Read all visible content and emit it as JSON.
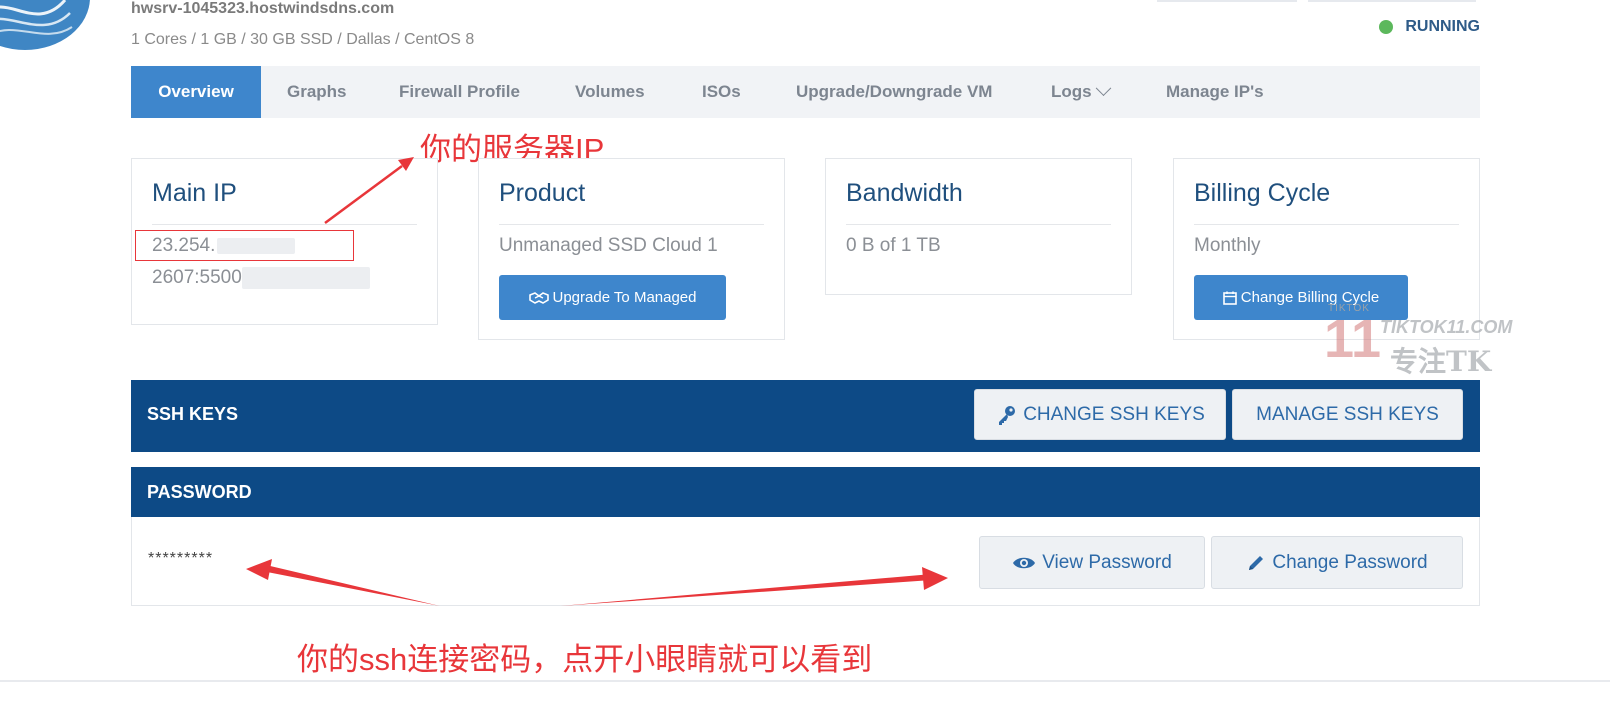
{
  "server": {
    "hostname": "hwsrv-1045323.hostwindsdns.com",
    "specs": "1 Cores / 1 GB / 30 GB SSD / Dallas / CentOS 8",
    "status": "RUNNING"
  },
  "tabs": [
    {
      "label": "Overview",
      "active": true
    },
    {
      "label": "Graphs",
      "active": false
    },
    {
      "label": "Firewall Profile",
      "active": false
    },
    {
      "label": "Volumes",
      "active": false
    },
    {
      "label": "ISOs",
      "active": false
    },
    {
      "label": "Upgrade/Downgrade VM",
      "active": false
    },
    {
      "label": "Logs",
      "active": false
    },
    {
      "label": "Manage IP's",
      "active": false
    }
  ],
  "cards": {
    "main_ip": {
      "title": "Main IP",
      "ipv4": "23.254.",
      "ipv6": "2607:5500"
    },
    "product": {
      "title": "Product",
      "value": "Unmanaged SSD Cloud 1",
      "button": "Upgrade To Managed"
    },
    "bandwidth": {
      "title": "Bandwidth",
      "value": "0 B of 1 TB"
    },
    "billing": {
      "title": "Billing Cycle",
      "value": "Monthly",
      "button": "Change Billing Cycle"
    }
  },
  "ssh_keys": {
    "title": "SSH KEYS",
    "change_button": "CHANGE SSH KEYS",
    "manage_button": "MANAGE SSH KEYS"
  },
  "password": {
    "title": "PASSWORD",
    "masked": "*********",
    "view_button": "View Password",
    "change_button": "Change Password"
  },
  "annotations": {
    "ip_note": "你的服务器IP",
    "password_note": "你的ssh连接密码，点开小眼睛就可以看到"
  },
  "watermark": {
    "small": "TIKTOK",
    "site": "TIKTOK11.COM",
    "number": "11",
    "slogan": "专注TK"
  },
  "colors": {
    "primary": "#3e86cc",
    "navy": "#0d4a86",
    "status_green": "#5cb85c",
    "annotation_red": "#e8363a"
  }
}
